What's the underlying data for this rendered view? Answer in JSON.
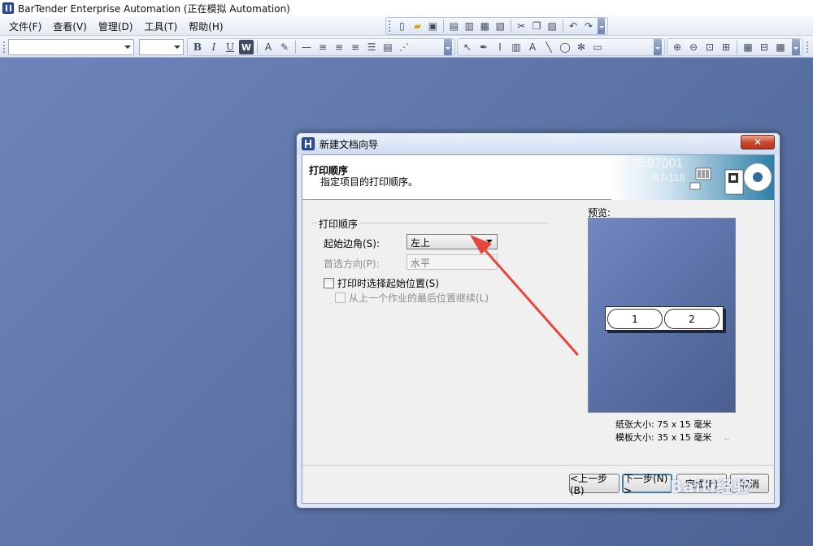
{
  "app": {
    "title": "BarTender Enterprise Automation (正在模拟 Automation)"
  },
  "menu": [
    {
      "label": "文件(F)"
    },
    {
      "label": "查看(V)"
    },
    {
      "label": "管理(D)"
    },
    {
      "label": "工具(T)"
    },
    {
      "label": "帮助(H)"
    }
  ],
  "format_toolbar": {
    "bold": "B",
    "italic": "I",
    "underline": "U",
    "word": "W",
    "font_color": "A"
  },
  "dialog": {
    "title": "新建文档向导",
    "close_label": "✕",
    "header_title": "打印顺序",
    "header_subtitle": "指定项目的打印顺序。",
    "header_art_text_1": "3597001",
    "header_art_text_2": "A7-118",
    "group_title": "打印顺序",
    "start_corner_label": "起始边角(S):",
    "start_corner_value": "左上",
    "direction_label": "首选方向(P):",
    "direction_value": "水平",
    "select_start_checkbox": "打印时选择起始位置(S)",
    "continue_checkbox": "从上一个作业的最后位置继续(L)",
    "preview_label": "预览:",
    "label_cells": [
      "1",
      "2"
    ],
    "paper_size": "纸张大小:  75 x 15 毫米",
    "template_size": "模板大小:  35 x 15 毫米",
    "dots": "..",
    "buttons": {
      "back": "<上一步(B)",
      "next": "下一步(N) >",
      "finish": "完成(F)",
      "cancel": "取消"
    },
    "watermark": "Baiti经验"
  },
  "colors": {
    "workspace": "#5f77aa",
    "annotation_arrow": "#e8463a",
    "default_button_border": "#3c7fb1"
  }
}
